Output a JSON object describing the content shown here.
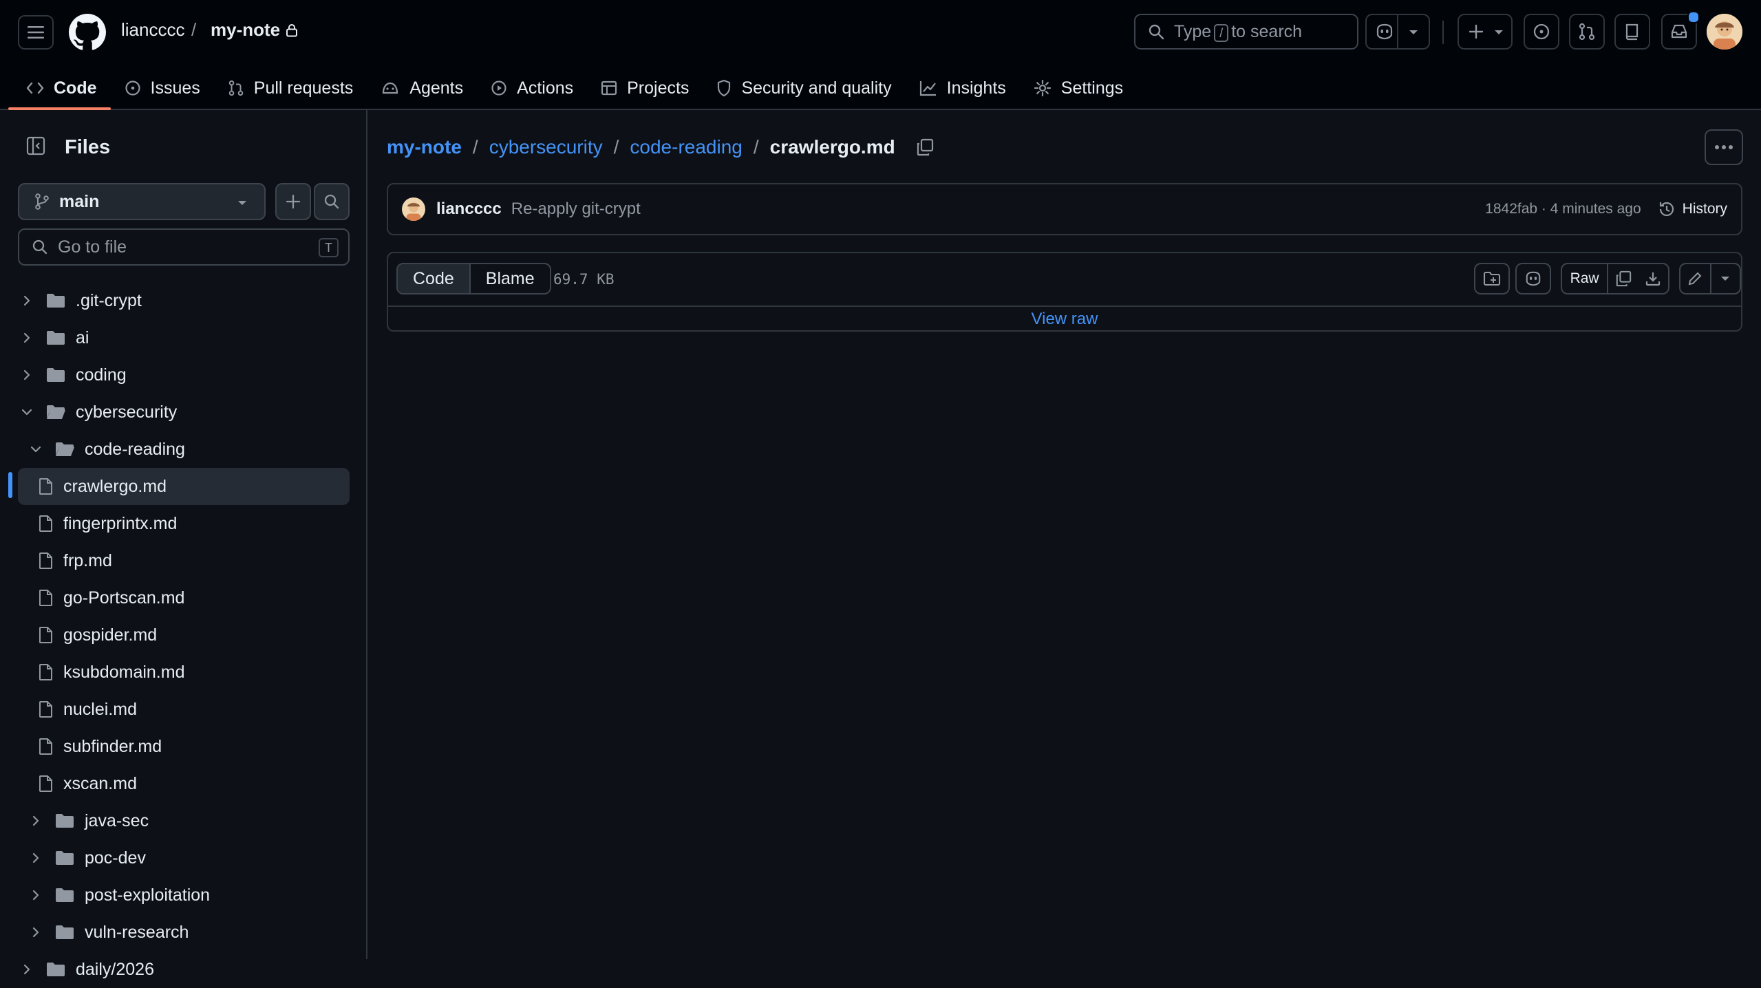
{
  "header": {
    "owner": "liancccc",
    "separator": "/",
    "repo": "my-note",
    "search_prefix": "Type",
    "search_key": "/",
    "search_suffix": "to search"
  },
  "nav": [
    {
      "label": "Code",
      "icon": "code-icon"
    },
    {
      "label": "Issues",
      "icon": "issue-icon"
    },
    {
      "label": "Pull requests",
      "icon": "pull-request-icon"
    },
    {
      "label": "Agents",
      "icon": "agents-icon"
    },
    {
      "label": "Actions",
      "icon": "actions-icon"
    },
    {
      "label": "Projects",
      "icon": "projects-icon"
    },
    {
      "label": "Security and quality",
      "icon": "shield-icon"
    },
    {
      "label": "Insights",
      "icon": "graph-icon"
    },
    {
      "label": "Settings",
      "icon": "gear-icon"
    }
  ],
  "sidebar": {
    "title": "Files",
    "branch": "main",
    "goto_placeholder": "Go to file",
    "goto_shortcut": "T",
    "tree": [
      {
        "label": ".git-crypt",
        "type": "folder",
        "level": 0,
        "expanded": false
      },
      {
        "label": "ai",
        "type": "folder",
        "level": 0,
        "expanded": false
      },
      {
        "label": "coding",
        "type": "folder",
        "level": 0,
        "expanded": false
      },
      {
        "label": "cybersecurity",
        "type": "folder",
        "level": 0,
        "expanded": true
      },
      {
        "label": "code-reading",
        "type": "folder",
        "level": 1,
        "expanded": true
      },
      {
        "label": "crawlergo.md",
        "type": "file",
        "level": 2,
        "selected": true
      },
      {
        "label": "fingerprintx.md",
        "type": "file",
        "level": 2
      },
      {
        "label": "frp.md",
        "type": "file",
        "level": 2
      },
      {
        "label": "go-Portscan.md",
        "type": "file",
        "level": 2
      },
      {
        "label": "gospider.md",
        "type": "file",
        "level": 2
      },
      {
        "label": "ksubdomain.md",
        "type": "file",
        "level": 2
      },
      {
        "label": "nuclei.md",
        "type": "file",
        "level": 2
      },
      {
        "label": "subfinder.md",
        "type": "file",
        "level": 2
      },
      {
        "label": "xscan.md",
        "type": "file",
        "level": 2
      },
      {
        "label": "java-sec",
        "type": "folder",
        "level": 1,
        "expanded": false
      },
      {
        "label": "poc-dev",
        "type": "folder",
        "level": 1,
        "expanded": false
      },
      {
        "label": "post-exploitation",
        "type": "folder",
        "level": 1,
        "expanded": false
      },
      {
        "label": "vuln-research",
        "type": "folder",
        "level": 1,
        "expanded": false
      },
      {
        "label": "daily/2026",
        "type": "folder",
        "level": 0,
        "expanded": false
      }
    ]
  },
  "path": {
    "repo": "my-note",
    "dir1": "cybersecurity",
    "dir2": "code-reading",
    "file": "crawlergo.md",
    "sep": "/"
  },
  "commit": {
    "author": "liancccc",
    "message": "Re-apply git-crypt",
    "meta": "1842fab · 4 minutes ago",
    "history_label": "History"
  },
  "file": {
    "tab_code": "Code",
    "tab_blame": "Blame",
    "size": "69.7 KB",
    "raw_label": "Raw",
    "view_raw": "View raw"
  },
  "colors": {
    "accent": "#4493f8",
    "active_underline": "#f78166",
    "background": "#0d1117",
    "header": "#010409"
  }
}
